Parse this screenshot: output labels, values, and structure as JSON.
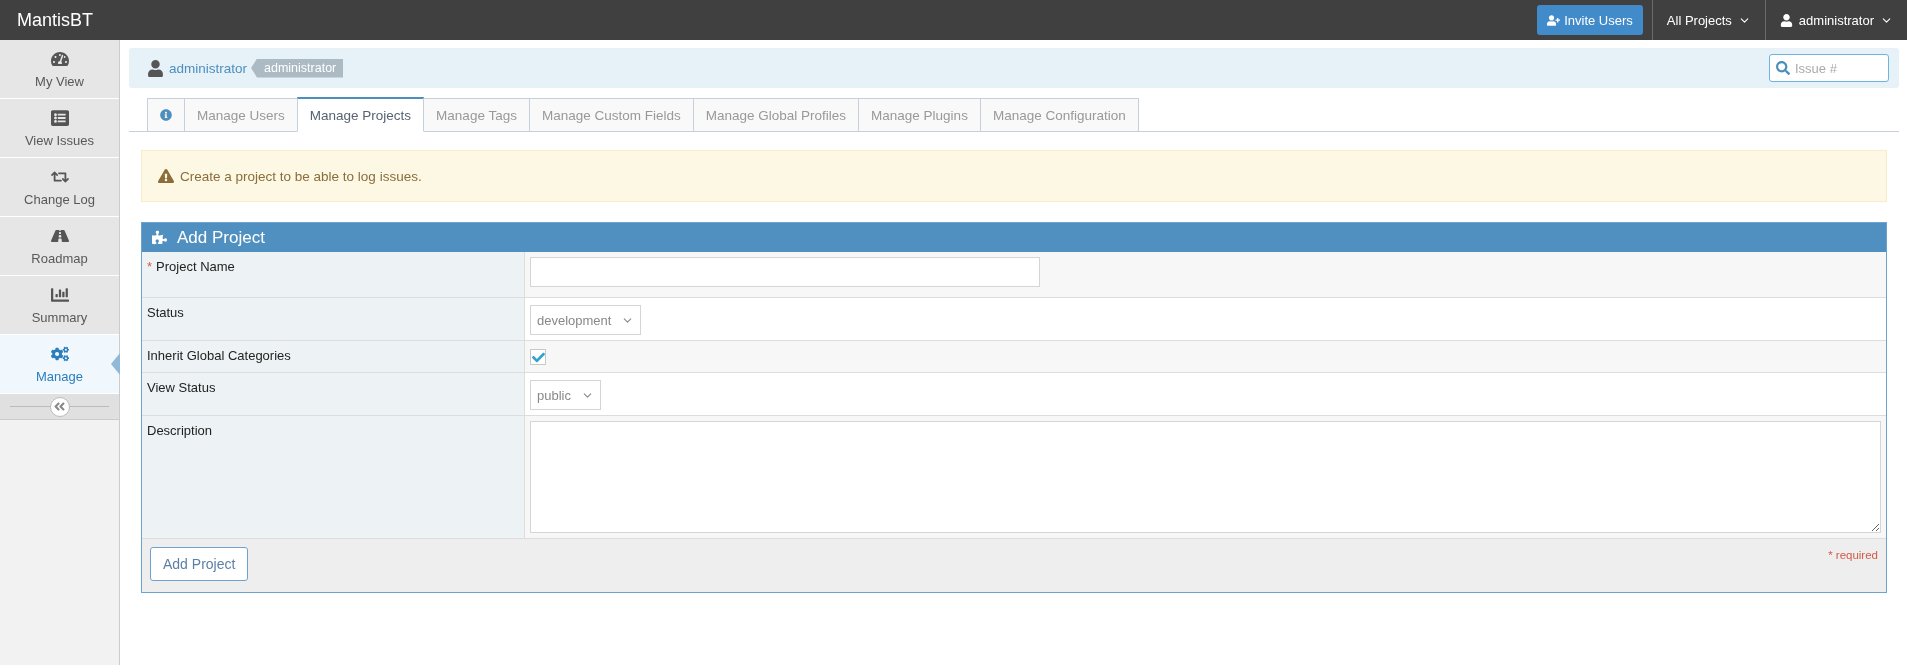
{
  "navbar": {
    "brand": "MantisBT",
    "invite_button": "Invite Users",
    "project_menu": "All Projects",
    "user_menu": "administrator"
  },
  "sidebar": {
    "items": [
      {
        "label": "My View",
        "kind": "dashboard",
        "selected": false
      },
      {
        "label": "View Issues",
        "kind": "list",
        "selected": false
      },
      {
        "label": "Change Log",
        "kind": "retweet",
        "selected": false
      },
      {
        "label": "Roadmap",
        "kind": "road",
        "selected": false
      },
      {
        "label": "Summary",
        "kind": "chart",
        "selected": false
      },
      {
        "label": "Manage",
        "kind": "cogs",
        "selected": true
      }
    ]
  },
  "breadcrumb": {
    "user_link": "administrator",
    "access_badge": "administrator",
    "search": {
      "placeholder": "Issue #"
    }
  },
  "tabs": [
    {
      "kind": "info",
      "selected": false
    },
    {
      "kind": "text",
      "label": "Manage Users",
      "selected": false
    },
    {
      "kind": "text",
      "label": "Manage Projects",
      "selected": true
    },
    {
      "kind": "text",
      "label": "Manage Tags",
      "selected": false
    },
    {
      "kind": "text",
      "label": "Manage Custom Fields",
      "selected": false
    },
    {
      "kind": "text",
      "label": "Manage Global Profiles",
      "selected": false
    },
    {
      "kind": "text",
      "label": "Manage Plugins",
      "selected": false
    },
    {
      "kind": "text",
      "label": "Manage Configuration",
      "selected": false
    }
  ],
  "alert": {
    "text": "Create a project to be able to log issues."
  },
  "form": {
    "title": "Add Project",
    "rows": [
      {
        "kind": "text",
        "label": "Project Name",
        "required_mark": "*"
      },
      {
        "kind": "select",
        "label": "Status",
        "value": "development"
      },
      {
        "kind": "checkbox",
        "label": "Inherit Global Categories",
        "checked": true
      },
      {
        "kind": "select",
        "label": "View Status",
        "value": "public"
      },
      {
        "kind": "textarea",
        "label": "Description"
      }
    ],
    "submit": "Add Project",
    "required_note": "* required"
  }
}
